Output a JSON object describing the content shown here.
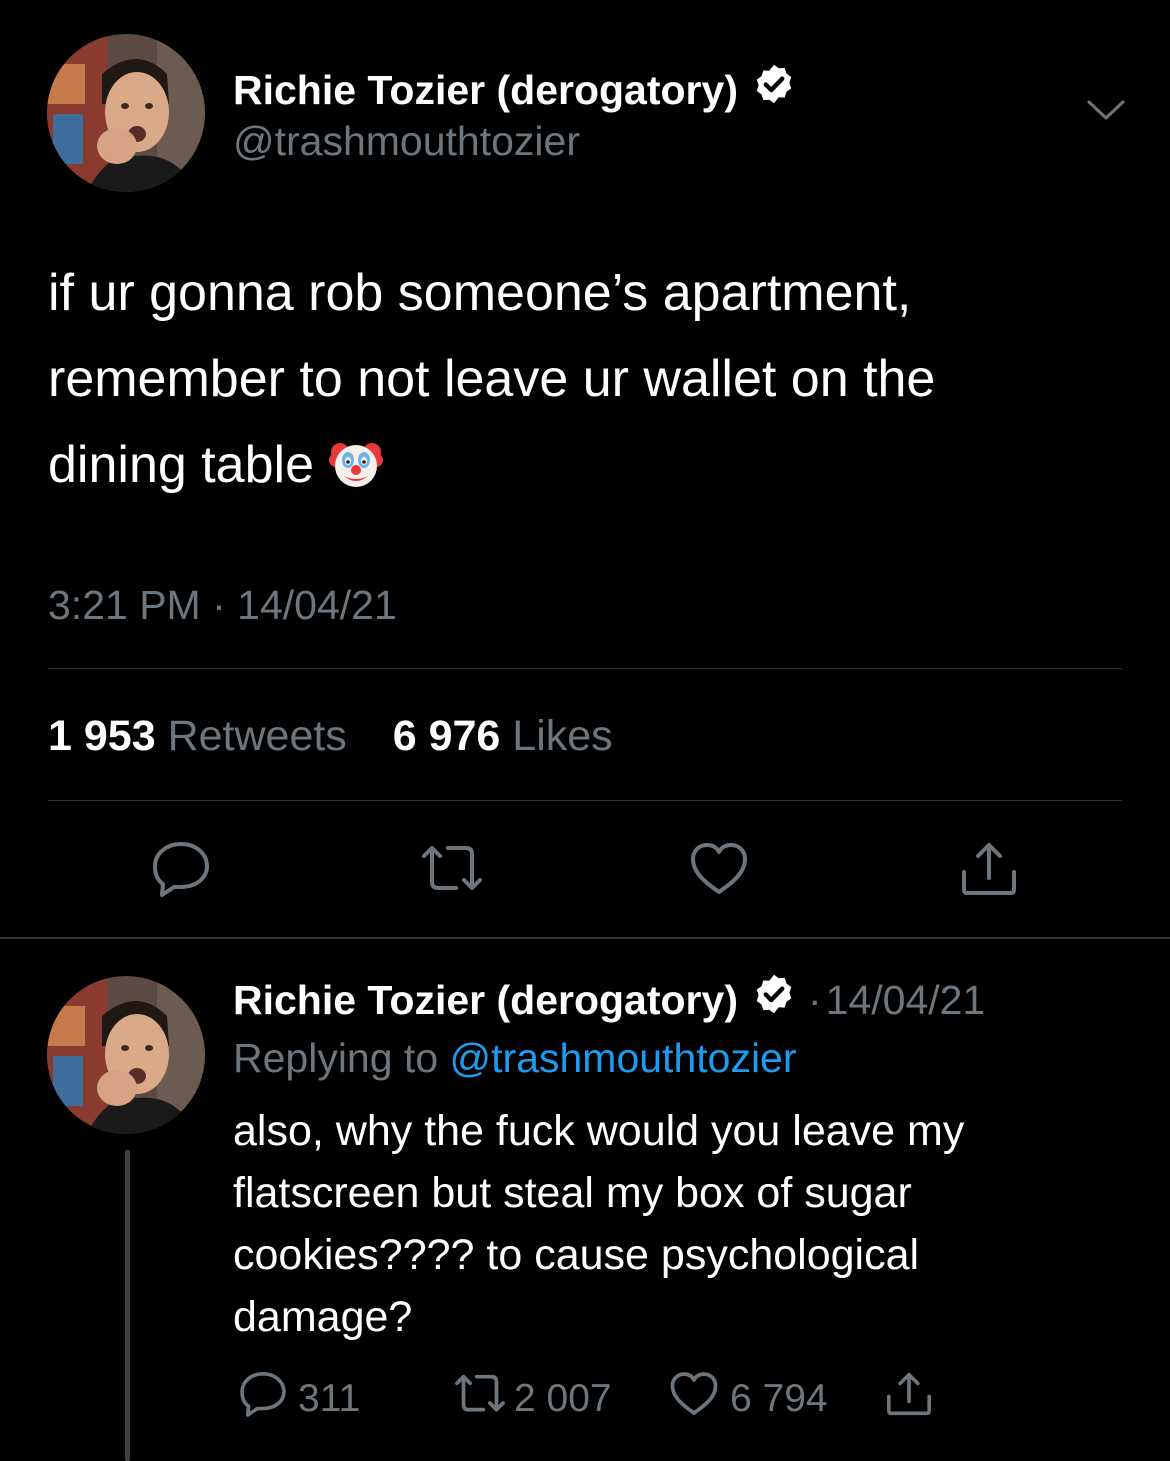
{
  "main_tweet": {
    "display_name": "Richie Tozier (derogatory)",
    "handle": "@trashmouthtozier",
    "text_lines": [
      "if ur gonna rob someone’s apartment,",
      "remember to not leave ur wallet on the",
      "dining table"
    ],
    "emoji": "clown-face",
    "time": "3:21 PM",
    "date": "14/04/21",
    "timestamp_separator": "·",
    "retweets_count": "1 953",
    "retweets_label": "Retweets",
    "likes_count": "6 976",
    "likes_label": "Likes",
    "actions": [
      "reply-icon",
      "retweet-icon",
      "like-icon",
      "share-icon"
    ]
  },
  "reply_tweet": {
    "display_name": "Richie Tozier (derogatory)",
    "separator": "·",
    "date": "14/04/21",
    "replying_prefix": "Replying to",
    "replying_to": "@trashmouthtozier",
    "text_lines": [
      "also, why the fuck would you leave my",
      "flatscreen but steal my box of sugar",
      "cookies???? to cause psychological",
      "damage?"
    ],
    "reply_count": "311",
    "retweet_count": "2 007",
    "like_count": "6 794"
  },
  "colors": {
    "background": "#000000",
    "text_primary": "#ffffff",
    "text_secondary": "#6e767d",
    "link": "#1d9bf0",
    "divider": "#2f3336",
    "verified": "#ffffff"
  }
}
